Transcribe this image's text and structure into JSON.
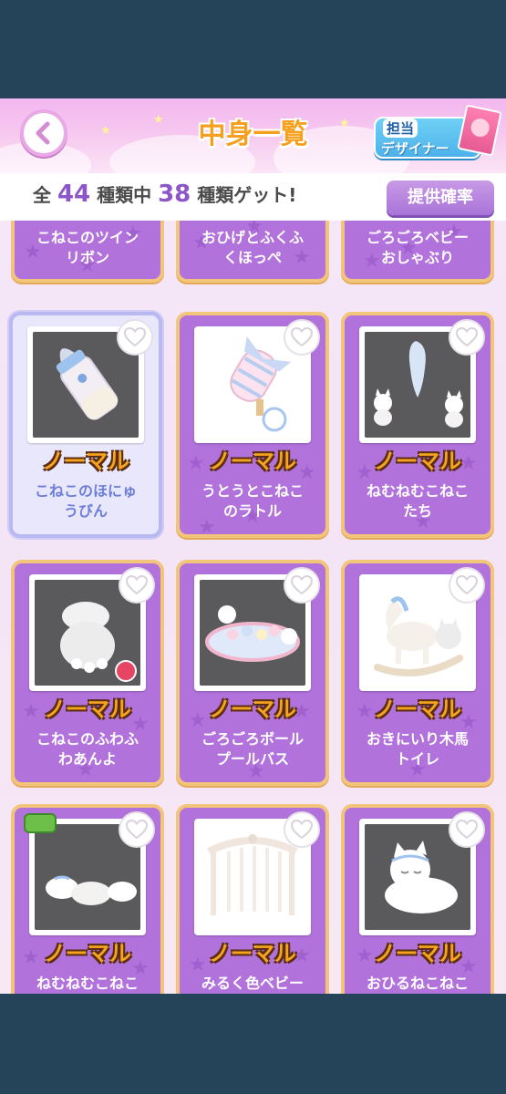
{
  "header": {
    "title": "中身一覧",
    "designer_line1": "担当",
    "designer_line2": "デザイナー"
  },
  "count": {
    "prefix": "全",
    "total": "44",
    "mid": "種類中",
    "got": "38",
    "suffix": "種類ゲット!"
  },
  "rate_button": "提供確率",
  "top_row": [
    {
      "name_l1": "こねこのツイン",
      "name_l2": "リボン"
    },
    {
      "name_l1": "おひげとふくふ",
      "name_l2": "くほっぺ"
    },
    {
      "name_l1": "ごろごろベビー",
      "name_l2": "おしゃぶり"
    }
  ],
  "items": [
    {
      "rarity": "ノーマル",
      "name_l1": "こねこのほにゅ",
      "name_l2": "うびん",
      "selected": true
    },
    {
      "rarity": "ノーマル",
      "name_l1": "うとうとこねこ",
      "name_l2": "のラトル"
    },
    {
      "rarity": "ノーマル",
      "name_l1": "ねむねむこねこ",
      "name_l2": "たち"
    },
    {
      "rarity": "ノーマル",
      "name_l1": "こねこのふわふ",
      "name_l2": "わあんよ"
    },
    {
      "rarity": "ノーマル",
      "name_l1": "ごろごろボール",
      "name_l2": "プールバス"
    },
    {
      "rarity": "ノーマル",
      "name_l1": "おきにいり木馬",
      "name_l2": "トイレ"
    },
    {
      "rarity": "ノーマル",
      "name_l1": "ねむねむこねこ",
      "name_l2": ""
    },
    {
      "rarity": "ノーマル",
      "name_l1": "みるく色ベビー",
      "name_l2": ""
    },
    {
      "rarity": "ノーマル",
      "name_l1": "おひるねこねこ",
      "name_l2": ""
    }
  ],
  "icons": {
    "back": "back-arrow-icon",
    "favorite": "heart-icon"
  },
  "colors": {
    "card_purple": "#b272dc",
    "card_border": "#f2c57b",
    "rarity_orange": "#f7a41d",
    "count_purple": "#8d56c8"
  }
}
